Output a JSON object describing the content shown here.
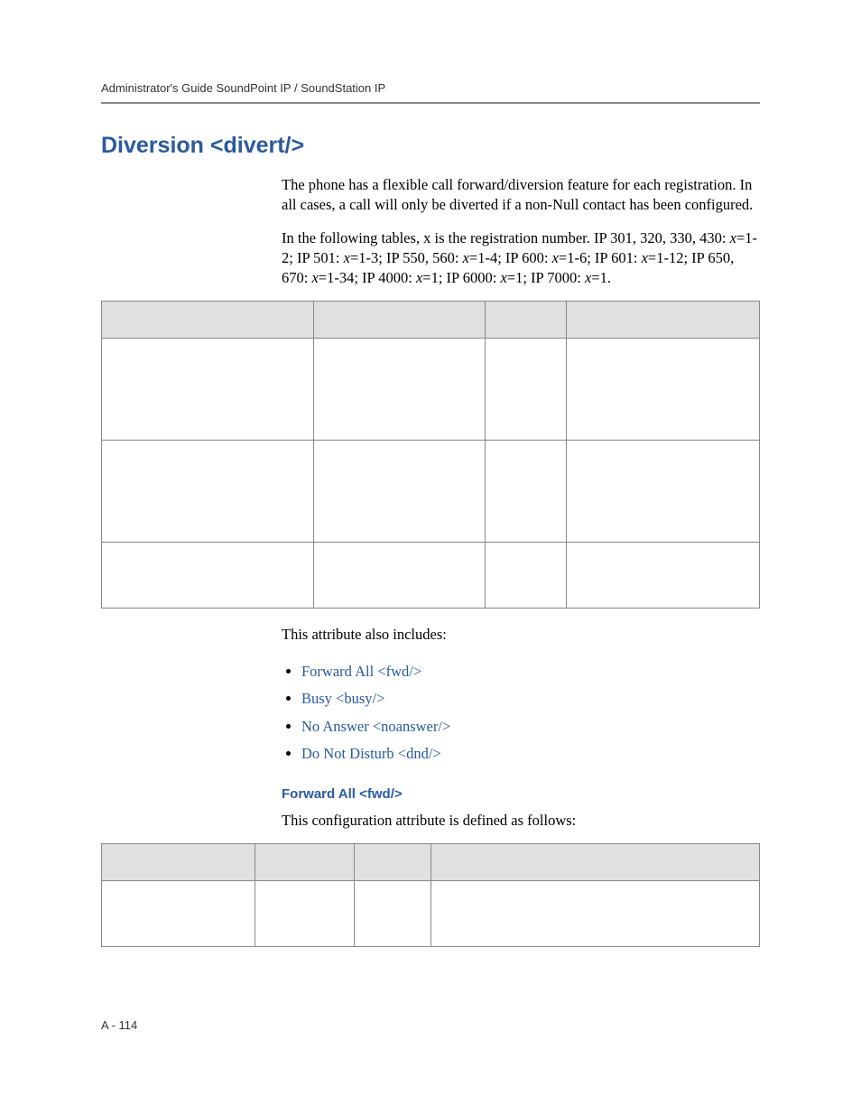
{
  "running_head": "Administrator's Guide SoundPoint IP / SoundStation IP",
  "h1": "Diversion <divert/>",
  "para1": "The phone has a flexible call forward/diversion feature for each registration. In all cases, a call will only be diverted if a non-Null contact has been configured.",
  "para2_plain_1": "In the following tables, x is the registration number. IP 301, 320, 330, 430: ",
  "para2_x1": "x",
  "para2_v1": "=1-2; IP 501: ",
  "para2_x2": "x",
  "para2_v2": "=1-3; IP 550, 560: ",
  "para2_x3": "x",
  "para2_v3": "=1-4; IP 600: ",
  "para2_x4": "x",
  "para2_v4": "=1-6; IP 601: ",
  "para2_x5": "x",
  "para2_v5": "=1-12; IP 650, 670: ",
  "para2_x6": "x",
  "para2_v6": "=1-34; IP 4000: ",
  "para2_x7": "x",
  "para2_v7": "=1; IP 6000: ",
  "para2_x8": "x",
  "para2_v8": "=1; IP 7000: ",
  "para2_x9": "x",
  "para2_v9": "=1.",
  "also_includes": "This attribute also includes:",
  "links": {
    "fwd": "Forward All <fwd/>",
    "busy": "Busy <busy/>",
    "noanswer": "No Answer <noanswer/>",
    "dnd": "Do Not Disturb <dnd/>"
  },
  "h3": "Forward All <fwd/>",
  "para3": "This configuration attribute is defined as follows:",
  "footer": "A - 114"
}
